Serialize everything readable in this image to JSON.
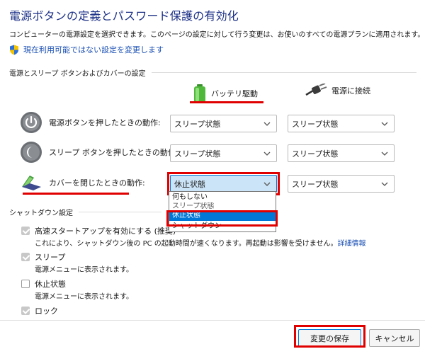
{
  "header": {
    "title": "電源ボタンの定義とパスワード保護の有効化",
    "description": "コンピューターの電源設定を選択できます。このページの設定に対して行う変更は、お使いのすべての電源プランに適用されます。",
    "change_settings_link": "現在利用可能ではない設定を変更します"
  },
  "power_section": {
    "heading": "電源とスリープ ボタンおよびカバーの設定",
    "col_battery": "バッテリ駆動",
    "col_plugged": "電源に接続",
    "rows": [
      {
        "label": "電源ボタンを押したときの動作:",
        "battery": "スリープ状態",
        "plugged": "スリープ状態"
      },
      {
        "label": "スリープ ボタンを押したときの動作:",
        "battery": "スリープ状態",
        "plugged": "スリープ状態"
      },
      {
        "label": "カバーを閉じたときの動作:",
        "battery": "休止状態",
        "plugged": "スリープ状態"
      }
    ],
    "dropdown_options": [
      "何もしない",
      "スリープ状態",
      "休止状態",
      "シャットダウン"
    ],
    "dropdown_selected": "休止状態"
  },
  "shutdown_section": {
    "heading": "シャットダウン設定",
    "items": [
      {
        "label": "高速スタートアップを有効にする (推奨)",
        "checked": true,
        "desc": "これにより、シャットダウン後の PC の起動時間が速くなります。再起動は影響を受けません。",
        "link": "詳細情報"
      },
      {
        "label": "スリープ",
        "checked": true,
        "desc": "電源メニューに表示されます。"
      },
      {
        "label": "休止状態",
        "checked": false,
        "desc": "電源メニューに表示されます。"
      },
      {
        "label": "ロック",
        "checked": true
      }
    ]
  },
  "footer": {
    "save_label": "変更の保存",
    "cancel_label": "キャンセル"
  },
  "colors": {
    "title": "#1e3287",
    "link": "#1a4fb3",
    "highlight": "#e00000",
    "selection": "#0078d7"
  }
}
